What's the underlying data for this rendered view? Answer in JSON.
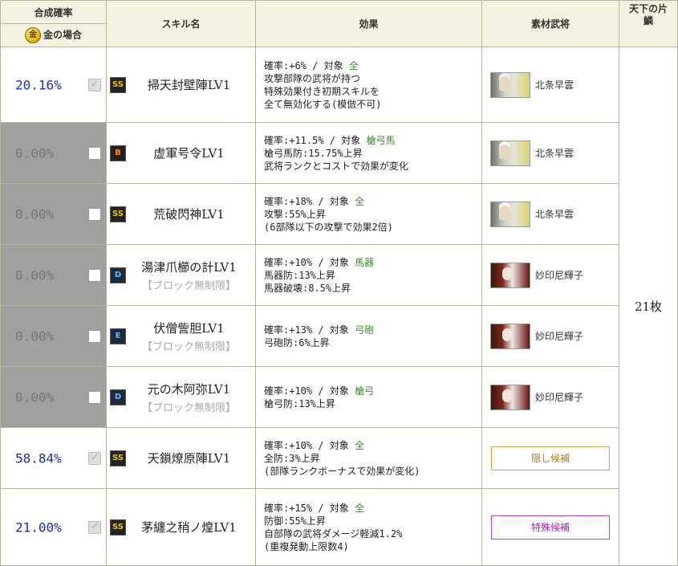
{
  "header": {
    "rate_title": "合成確率",
    "gold_icon_text": "金",
    "gold_label": "金の場合",
    "skill_col": "スキル名",
    "effect_col": "効果",
    "material_col": "素材武将",
    "count_col": "天下の片鱗"
  },
  "count_value": "21枚",
  "rows": [
    {
      "rate": "20.16%",
      "checked": true,
      "locked": false,
      "rank": "SS",
      "rank_class": "ss",
      "name": "掃天封壁陣LV1",
      "note": "",
      "effect": {
        "rate": "確率:+6%",
        "sep": " / ",
        "target_label": "対象",
        "target": "全",
        "lines": [
          "攻撃部隊の武将が持つ",
          "特殊効果付き初期スキルを",
          "全て無効化する(模倣不可)"
        ]
      },
      "material": {
        "type": "general",
        "portrait": "p1",
        "name": "北条早雲"
      }
    },
    {
      "rate": "0.00%",
      "checked": false,
      "locked": true,
      "rank": "B",
      "rank_class": "b",
      "name": "虚軍号令LV1",
      "note": "",
      "effect": {
        "rate": "確率:+11.5%",
        "sep": " / ",
        "target_label": "対象",
        "target": "槍弓馬",
        "lines": [
          "槍弓馬防:15.75%上昇",
          "武将ランクとコストで効果が変化"
        ]
      },
      "material": {
        "type": "general",
        "portrait": "p1",
        "name": "北条早雲"
      }
    },
    {
      "rate": "0.00%",
      "checked": false,
      "locked": true,
      "rank": "SS",
      "rank_class": "ss",
      "name": "荒破閃神LV1",
      "note": "",
      "effect": {
        "rate": "確率:+18%",
        "sep": " / ",
        "target_label": "対象",
        "target": "全",
        "lines": [
          "攻撃:55%上昇",
          "(6部隊以下の攻撃で効果2倍)"
        ]
      },
      "material": {
        "type": "general",
        "portrait": "p1",
        "name": "北条早雲"
      }
    },
    {
      "rate": "0.00%",
      "checked": false,
      "locked": true,
      "rank": "D",
      "rank_class": "d",
      "name": "湯津爪櫛の計LV1",
      "note": "【ブロック無制限】",
      "effect": {
        "rate": "確率:+10%",
        "sep": " / ",
        "target_label": "対象",
        "target": "馬器",
        "lines": [
          "馬器防:13%上昇",
          "馬器破壊:8.5%上昇"
        ]
      },
      "material": {
        "type": "general",
        "portrait": "p2",
        "name": "妙印尼輝子"
      }
    },
    {
      "rate": "0.00%",
      "checked": false,
      "locked": true,
      "rank": "E",
      "rank_class": "e",
      "name": "伏僧訾胆LV1",
      "note": "【ブロック無制限】",
      "effect": {
        "rate": "確率:+13%",
        "sep": " / ",
        "target_label": "対象",
        "target": "弓砲",
        "lines": [
          "弓砲防:6%上昇"
        ]
      },
      "material": {
        "type": "general",
        "portrait": "p2",
        "name": "妙印尼輝子"
      }
    },
    {
      "rate": "0.00%",
      "checked": false,
      "locked": true,
      "rank": "D",
      "rank_class": "d",
      "name": "元の木阿弥LV1",
      "note": "【ブロック無制限】",
      "effect": {
        "rate": "確率:+10%",
        "sep": " / ",
        "target_label": "対象",
        "target": "槍弓",
        "lines": [
          "槍弓防:13%上昇"
        ]
      },
      "material": {
        "type": "general",
        "portrait": "p2",
        "name": "妙印尼輝子"
      }
    },
    {
      "rate": "58.84%",
      "checked": true,
      "locked": false,
      "rank": "SS",
      "rank_class": "ss",
      "name": "天鎖燎原陣LV1",
      "note": "",
      "effect": {
        "rate": "確率:+10%",
        "sep": " / ",
        "target_label": "対象",
        "target": "全",
        "lines": [
          "全防:3%上昇",
          "(部隊ランクボーナスで効果が変化)"
        ]
      },
      "material": {
        "type": "button",
        "style": "hidden-c",
        "label": "隠し候補"
      }
    },
    {
      "rate": "21.00%",
      "checked": true,
      "locked": false,
      "rank": "SS",
      "rank_class": "ss",
      "name": "茅纏之稍ノ煌LV1",
      "note": "",
      "effect": {
        "rate": "確率:+15%",
        "sep": " / ",
        "target_label": "対象",
        "target": "全",
        "lines": [
          "防御:55%上昇",
          "自部隊の武将ダメージ軽減1.2%",
          "(重複発動上限数4)"
        ]
      },
      "material": {
        "type": "button",
        "style": "special-c",
        "label": "特殊候補"
      }
    }
  ]
}
